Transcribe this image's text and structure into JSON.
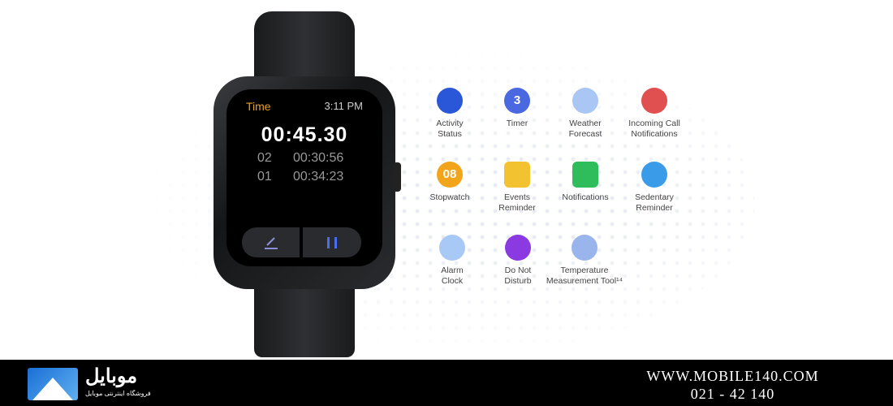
{
  "watch": {
    "app_title": "Time",
    "clock": "3:11 PM",
    "stopwatch": "00:45.30",
    "laps": [
      {
        "n": "02",
        "t": "00:30:56"
      },
      {
        "n": "01",
        "t": "00:34:23"
      }
    ],
    "accent": "#e8a020",
    "buttons": [
      {
        "icon": "edit-icon"
      },
      {
        "icon": "pause-icon"
      }
    ]
  },
  "features": [
    {
      "label": "Activity\nStatus",
      "icon": "activity-icon",
      "color": "#2a56d8"
    },
    {
      "label": "Timer",
      "icon": "timer-icon",
      "glyph": "3",
      "color": "#4a68e0"
    },
    {
      "label": "Weather\nForecast",
      "icon": "cloud-icon",
      "color": "#a9c6f5"
    },
    {
      "label": "Incoming Call\nNotifications",
      "icon": "bell-icon",
      "color": "#e05050"
    },
    {
      "label": "Stopwatch",
      "icon": "stopwatch-icon",
      "glyph": "08",
      "color": "#f2a51a"
    },
    {
      "label": "Events\nReminder",
      "icon": "calendar-check-icon",
      "color": "#f2c230"
    },
    {
      "label": "Notifications",
      "icon": "message-icon",
      "color": "#2ebd5a"
    },
    {
      "label": "Sedentary\nReminder",
      "icon": "stretch-icon",
      "color": "#3a9ce8"
    },
    {
      "label": "Alarm\nClock",
      "icon": "alarm-clock-icon",
      "color": "#a8c8f5"
    },
    {
      "label": "Do Not\nDisturb",
      "icon": "moon-icon",
      "color": "#8a3ae0"
    },
    {
      "label": "Temperature\nMeasurement Tool¹⁴",
      "icon": "thermometer-icon",
      "color": "#9ab4ec"
    }
  ],
  "footer": {
    "brand": "موبایل",
    "brand_badge": "140",
    "tagline": "فروشگاه اینترنتی موبایل",
    "url": "WWW.MOBILE140.COM",
    "phone": "021 - 42 140"
  }
}
